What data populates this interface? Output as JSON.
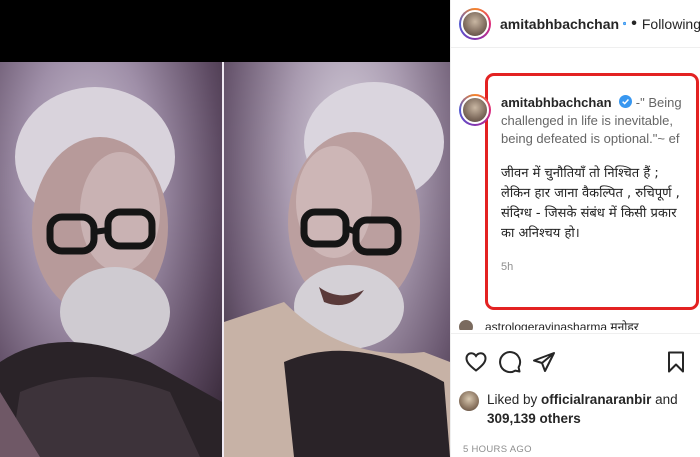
{
  "post": {
    "username": "amitabhbachchan",
    "follow_status": "Following",
    "separator": "•"
  },
  "caption": {
    "username": "amitabhbachchan",
    "english": "-\" Being challenged in life is inevitable, being defeated is optional.\"~ ef",
    "hindi": "जीवन में चुनौतियाँ तो निश्चित हैं ; लेकिन हार जाना वैकल्पित , रुचिपूर्ण , संदिग्ध - जिसके संबंध में किसी प्रकार का अनिश्चय हो।",
    "time": "5h"
  },
  "comment_peek": {
    "text": "astrologeravinasharma मनोहर"
  },
  "likes": {
    "prefix": "Liked by ",
    "user": "officialranaranbir",
    "and": " and",
    "count": "309,139 others"
  },
  "post_time": "5 HOURS AGO",
  "icons": [
    "verified-badge-icon",
    "heart-icon",
    "comment-icon",
    "share-icon",
    "bookmark-icon"
  ],
  "colors": {
    "highlight_border": "#e32222",
    "verified": "#3897f0",
    "muted": "#8e8e8e"
  }
}
